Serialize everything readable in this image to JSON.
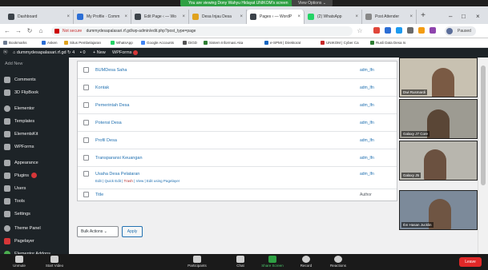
{
  "zoom_banner": {
    "text": "You are viewing Dony Wahyu Hidayat UNIKOM's screen",
    "view_options": "View Options ⌄"
  },
  "tabs": [
    {
      "label": "Dashboard"
    },
    {
      "label": "My Profile · Comm"
    },
    {
      "label": "Edit Page ‹ — Wo"
    },
    {
      "label": "Desa Injau Desa"
    },
    {
      "label": "Pages ‹ — WordP"
    },
    {
      "label": "(2) WhatsApp"
    },
    {
      "label": "Post Attender"
    }
  ],
  "address_bar": {
    "security": "Not secure",
    "url": "dummydesapalasari.rf.gd/wp-admin/edit.php?post_type=page"
  },
  "profile": {
    "status": "Paused"
  },
  "bookmarks": [
    {
      "label": "Bookmarks",
      "color": "#6b7a90"
    },
    {
      "label": "Asken",
      "color": "#2c6ed5"
    },
    {
      "label": "Situs Pembelajaran",
      "color": "#e0a21e"
    },
    {
      "label": "WhatsApp",
      "color": "#25d366"
    },
    {
      "label": "Google Accounts",
      "color": "#4285f4"
    },
    {
      "label": "DiGD",
      "color": "#555555"
    },
    {
      "label": "Sistem Informasi Aka",
      "color": "#2e7d32"
    },
    {
      "label": "e-SPMI | Direktorat",
      "color": "#1565c0"
    },
    {
      "label": "UNIKOM | Cyber Ca",
      "color": "#c62828"
    },
    {
      "label": "Rusli Data Desa Is",
      "color": "#2e7d32"
    }
  ],
  "admin_bar": {
    "site": "dummydesapalasari.rf.gd",
    "updates": "4",
    "comments": "0",
    "new": "+ New",
    "wpforms": "WPForms"
  },
  "sidebar": [
    {
      "label": "Add New",
      "sub": true
    },
    {
      "label": "Comments"
    },
    {
      "label": "3D FlipBook"
    },
    {
      "label": "Elementor"
    },
    {
      "label": "Templates"
    },
    {
      "label": "ElementsKit"
    },
    {
      "label": "WPForms"
    },
    {
      "label": "Appearance"
    },
    {
      "label": "Plugins",
      "badge": true
    },
    {
      "label": "Users"
    },
    {
      "label": "Tools"
    },
    {
      "label": "Settings"
    },
    {
      "label": "Theme Panel"
    },
    {
      "label": "Pagelayer"
    },
    {
      "label": "Elementor Addons"
    }
  ],
  "pages": [
    {
      "title": "BUMDesa Saha",
      "author": "adm_lfn"
    },
    {
      "title": "Kontak",
      "author": "adm_lfn"
    },
    {
      "title": "Pemerintah Desa",
      "author": "adm_lfn"
    },
    {
      "title": "Potensi Desa",
      "author": "adm_lfn"
    },
    {
      "title": "Profil Desa",
      "author": "adm_lfn"
    },
    {
      "title": "Transparansi Keuangan",
      "author": "adm_lfn"
    },
    {
      "title": "Usaha Desa Pelataran",
      "author": "adm_lfn"
    }
  ],
  "row_actions": {
    "edit": "Edit",
    "quick_edit": "Quick Edit",
    "trash": "Trash",
    "view": "View",
    "pagelayer": "Edit using Pagelayer"
  },
  "table_footer": {
    "title": "Title",
    "author": "Author"
  },
  "bulk": {
    "select": "Bulk Actions  ⌄",
    "apply": "Apply"
  },
  "video_tiles": [
    {
      "name": "Dwi Rusmardi"
    },
    {
      "name": "Galaxy J7 Core"
    },
    {
      "name": "Galaxy J5"
    },
    {
      "name": "Ibn Hasan Jucklin"
    }
  ],
  "zoom_controls": [
    {
      "label": "Unmute",
      "icon": "microphone-icon"
    },
    {
      "label": "Start Video",
      "icon": "video-icon"
    },
    {
      "label": "Participants",
      "icon": "participants-icon",
      "count": "5"
    },
    {
      "label": "Chat",
      "icon": "chat-icon"
    },
    {
      "label": "Share Screen",
      "icon": "share-screen-icon"
    },
    {
      "label": "Record",
      "icon": "record-icon"
    },
    {
      "label": "Reactions",
      "icon": "reactions-icon"
    }
  ],
  "leave": "Leave",
  "colors": {
    "wp_dark": "#1d2327",
    "wp_link": "#2271b1",
    "zoom_green": "#2ea043",
    "leave_red": "#e02828"
  }
}
